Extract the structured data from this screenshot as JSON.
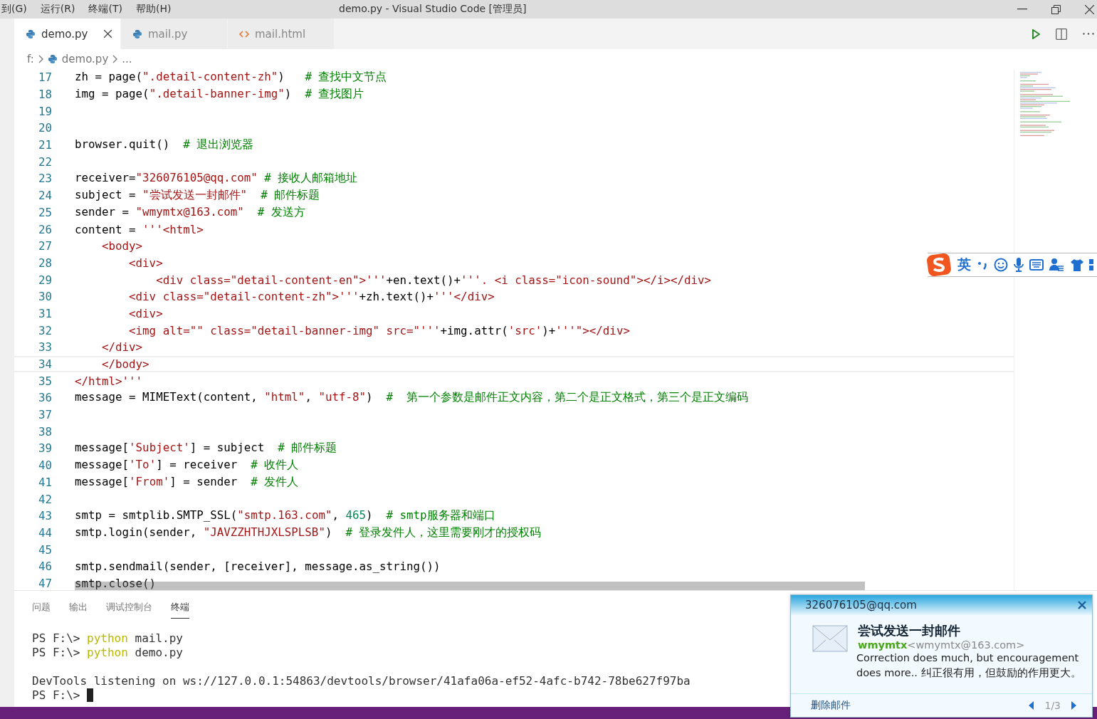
{
  "menu": [
    "到(G)",
    "运行(R)",
    "终端(T)",
    "帮助(H)"
  ],
  "window": {
    "title": "demo.py - Visual Studio Code [管理员]"
  },
  "tabs": [
    {
      "label": "demo.py",
      "kind": "python",
      "selected": true
    },
    {
      "label": "mail.py",
      "kind": "python",
      "selected": false
    },
    {
      "label": "mail.html",
      "kind": "html",
      "selected": false
    }
  ],
  "breadcrumb": {
    "root": "f:",
    "file": "demo.py",
    "more": "..."
  },
  "code_lines": [
    {
      "n": "17",
      "current": false,
      "tokens": [
        {
          "kind": "code",
          "text": "zh = page("
        },
        {
          "kind": "string",
          "text": "\".detail-content-zh\""
        },
        {
          "kind": "code",
          "text": ")   "
        },
        {
          "kind": "comment",
          "text": "# 查找中文节点"
        }
      ]
    },
    {
      "n": "18",
      "current": false,
      "tokens": [
        {
          "kind": "code",
          "text": "img = page("
        },
        {
          "kind": "string",
          "text": "\".detail-banner-img\""
        },
        {
          "kind": "code",
          "text": ")  "
        },
        {
          "kind": "comment",
          "text": "# 查找图片"
        }
      ]
    },
    {
      "n": "19",
      "current": false
    },
    {
      "n": "20",
      "current": false
    },
    {
      "n": "21",
      "current": false,
      "tokens": [
        {
          "kind": "code",
          "text": "browser.quit()  "
        },
        {
          "kind": "comment",
          "text": "# 退出浏览器"
        }
      ]
    },
    {
      "n": "22",
      "current": false
    },
    {
      "n": "23",
      "current": false,
      "tokens": [
        {
          "kind": "code",
          "text": "receiver="
        },
        {
          "kind": "string",
          "text": "\"326076105@qq.com\""
        },
        {
          "kind": "comment",
          "text": " # 接收人邮箱地址"
        }
      ]
    },
    {
      "n": "24",
      "current": false,
      "tokens": [
        {
          "kind": "code",
          "text": "subject = "
        },
        {
          "kind": "string",
          "text": "\"尝试发送一封邮件\""
        },
        {
          "kind": "comment",
          "text": "  # 邮件标题"
        }
      ]
    },
    {
      "n": "25",
      "current": false,
      "tokens": [
        {
          "kind": "code",
          "text": "sender = "
        },
        {
          "kind": "string",
          "text": "\"wmymtx@163.com\""
        },
        {
          "kind": "comment",
          "text": "  # 发送方"
        }
      ]
    },
    {
      "n": "26",
      "current": false,
      "tokens": [
        {
          "kind": "code",
          "text": "content = "
        },
        {
          "kind": "string",
          "text": "'''<html>"
        }
      ]
    },
    {
      "n": "27",
      "current": false,
      "tokens": [
        {
          "kind": "string",
          "text": "    <body>"
        }
      ]
    },
    {
      "n": "28",
      "current": false,
      "tokens": [
        {
          "kind": "string",
          "text": "        <div>"
        }
      ]
    },
    {
      "n": "29",
      "current": false,
      "tokens": [
        {
          "kind": "string",
          "text": "            <div class=\"detail-content-en\">'''"
        },
        {
          "kind": "code",
          "text": "+en.text()+"
        },
        {
          "kind": "string",
          "text": "'''. <i class=\"icon-sound\"></i></div>"
        }
      ]
    },
    {
      "n": "30",
      "current": false,
      "tokens": [
        {
          "kind": "string",
          "text": "        <div class=\"detail-content-zh\">'''"
        },
        {
          "kind": "code",
          "text": "+zh.text()+"
        },
        {
          "kind": "string",
          "text": "'''</div>"
        }
      ]
    },
    {
      "n": "31",
      "current": false,
      "tokens": [
        {
          "kind": "string",
          "text": "        <div>"
        }
      ]
    },
    {
      "n": "32",
      "current": false,
      "tokens": [
        {
          "kind": "string",
          "text": "        <img alt=\"\" class=\"detail-banner-img\" src=\"'''"
        },
        {
          "kind": "code",
          "text": "+img.attr("
        },
        {
          "kind": "string",
          "text": "'src'"
        },
        {
          "kind": "code",
          "text": ")+"
        },
        {
          "kind": "string",
          "text": "'''\"></div>"
        }
      ]
    },
    {
      "n": "33",
      "current": false,
      "tokens": [
        {
          "kind": "string",
          "text": "    </div>"
        }
      ]
    },
    {
      "n": "34",
      "current": true,
      "tokens": [
        {
          "kind": "string",
          "text": "    </body>"
        }
      ]
    },
    {
      "n": "35",
      "current": false,
      "tokens": [
        {
          "kind": "string",
          "text": "</html>'''"
        }
      ]
    },
    {
      "n": "36",
      "current": false,
      "tokens": [
        {
          "kind": "code",
          "text": "message = MIMEText(content, "
        },
        {
          "kind": "string",
          "text": "\"html\""
        },
        {
          "kind": "code",
          "text": ", "
        },
        {
          "kind": "string",
          "text": "\"utf-8\""
        },
        {
          "kind": "code",
          "text": ")  "
        },
        {
          "kind": "comment",
          "text": "#  第一个参数是邮件正文内容，第二个是正文格式，第三个是正文编码"
        }
      ]
    },
    {
      "n": "37",
      "current": false
    },
    {
      "n": "38",
      "current": false
    },
    {
      "n": "39",
      "current": false,
      "tokens": [
        {
          "kind": "code",
          "text": "message["
        },
        {
          "kind": "string",
          "text": "'Subject'"
        },
        {
          "kind": "code",
          "text": "] = subject  "
        },
        {
          "kind": "comment",
          "text": "# 邮件标题"
        }
      ]
    },
    {
      "n": "40",
      "current": false,
      "tokens": [
        {
          "kind": "code",
          "text": "message["
        },
        {
          "kind": "string",
          "text": "'To'"
        },
        {
          "kind": "code",
          "text": "] = receiver  "
        },
        {
          "kind": "comment",
          "text": "# 收件人"
        }
      ]
    },
    {
      "n": "41",
      "current": false,
      "tokens": [
        {
          "kind": "code",
          "text": "message["
        },
        {
          "kind": "string",
          "text": "'From'"
        },
        {
          "kind": "code",
          "text": "] = sender  "
        },
        {
          "kind": "comment",
          "text": "# 发件人"
        }
      ]
    },
    {
      "n": "42",
      "current": false
    },
    {
      "n": "43",
      "current": false,
      "tokens": [
        {
          "kind": "code",
          "text": "smtp = smtplib.SMTP_SSL("
        },
        {
          "kind": "string",
          "text": "\"smtp.163.com\""
        },
        {
          "kind": "code",
          "text": ", "
        },
        {
          "kind": "number",
          "text": "465"
        },
        {
          "kind": "code",
          "text": ")  "
        },
        {
          "kind": "comment",
          "text": "# smtp服务器和端口"
        }
      ]
    },
    {
      "n": "44",
      "current": false,
      "tokens": [
        {
          "kind": "code",
          "text": "smtp.login(sender, "
        },
        {
          "kind": "string",
          "text": "\"JAVZZHTHJXLSPLSB\""
        },
        {
          "kind": "code",
          "text": ")  "
        },
        {
          "kind": "comment",
          "text": "# 登录发件人，这里需要刚才的授权码"
        }
      ]
    },
    {
      "n": "45",
      "current": false
    },
    {
      "n": "46",
      "current": false,
      "tokens": [
        {
          "kind": "code",
          "text": "smtp.sendmail(sender, [receiver], message.as_string())"
        }
      ]
    },
    {
      "n": "47",
      "current": false,
      "tokens": [
        {
          "kind": "code",
          "text": "smtp.close()"
        }
      ]
    }
  ],
  "ime_toolbar": {
    "mode": "英"
  },
  "panel_tabs": [
    {
      "label": "问题",
      "selected": false
    },
    {
      "label": "输出",
      "selected": false
    },
    {
      "label": "调试控制台",
      "selected": false
    },
    {
      "label": "终端",
      "selected": true
    }
  ],
  "terminal_lines": [
    {
      "gap_before": false,
      "cursor": false,
      "tokens": [
        {
          "kind": "plain",
          "text": "PS F:\\> "
        },
        {
          "kind": "command",
          "text": "python"
        },
        {
          "kind": "plain",
          "text": " mail.py"
        }
      ]
    },
    {
      "gap_before": false,
      "cursor": false,
      "tokens": [
        {
          "kind": "plain",
          "text": "PS F:\\> "
        },
        {
          "kind": "command",
          "text": "python"
        },
        {
          "kind": "plain",
          "text": " demo.py"
        }
      ]
    },
    {
      "gap_before": true,
      "cursor": false,
      "tokens": [
        {
          "kind": "plain",
          "text": "DevTools listening on ws://127.0.0.1:54863/devtools/browser/41afa06a-ef52-4afc-b742-78be627f97ba"
        }
      ]
    },
    {
      "gap_before": false,
      "cursor": true,
      "tokens": [
        {
          "kind": "plain",
          "text": "PS F:\\> "
        }
      ]
    }
  ],
  "notification": {
    "account": "326076105@qq.com",
    "subject": "尝试发送一封邮件",
    "sender_name": "wmymtx",
    "sender_address": "<wmymtx@163.com>",
    "preview": "Correction does much, but encouragement does more.. 纠正很有用，但鼓励的作用更大。",
    "delete_link": "删除邮件",
    "pager": "1/3"
  }
}
